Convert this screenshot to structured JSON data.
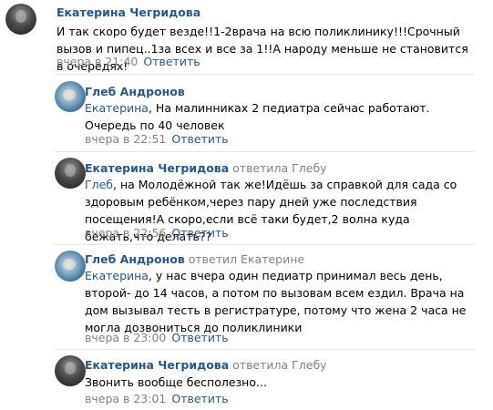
{
  "comments": [
    {
      "author": "Екатерина Чегридова",
      "reply_to": "",
      "mention": "",
      "text": "И так скоро будет везде!!1-2врача на всю поликлинику!!!Срочный вызов и пипец..1за всех и все за 1!!А народу меньше не становится в очередях!",
      "time": "вчера в 21:40",
      "reply_label": "Ответить"
    },
    {
      "author": "Глеб Андронов",
      "reply_to": "",
      "mention": "Екатерина",
      "text": ", На малинниках 2 педиатра сейчас работают. Очередь по 40 человек",
      "time": "вчера в 22:51",
      "reply_label": "Ответить"
    },
    {
      "author": "Екатерина Чегридова",
      "reply_to": "ответила Глебу",
      "mention": "Глеб",
      "text": ", на Молодёжной так же!Идёшь за справкой для сада со здоровым ребёнком,через пару дней уже последствия посещения!А скоро,если всё таки будет,2 волна куда бежать,что делать??",
      "time": "вчера в 22:56",
      "reply_label": "Ответить"
    },
    {
      "author": "Глеб Андронов",
      "reply_to": "ответил Екатерине",
      "mention": "Екатерина",
      "text": ", у нас вчера один педиатр принимал весь день, второй- до 14 часов, а потом по вызовам всем ездил. Врача на дом вызывал тесть в регистратуре, потому что жена 2 часа не могла дозвониться до поликлиники",
      "time": "вчера в 23:00",
      "reply_label": "Ответить"
    },
    {
      "author": "Екатерина Чегридова",
      "reply_to": "ответила Глебу",
      "mention": "",
      "text": "Звонить вообще бесполезно...",
      "time": "вчера в 23:01",
      "reply_label": "Ответить"
    }
  ]
}
